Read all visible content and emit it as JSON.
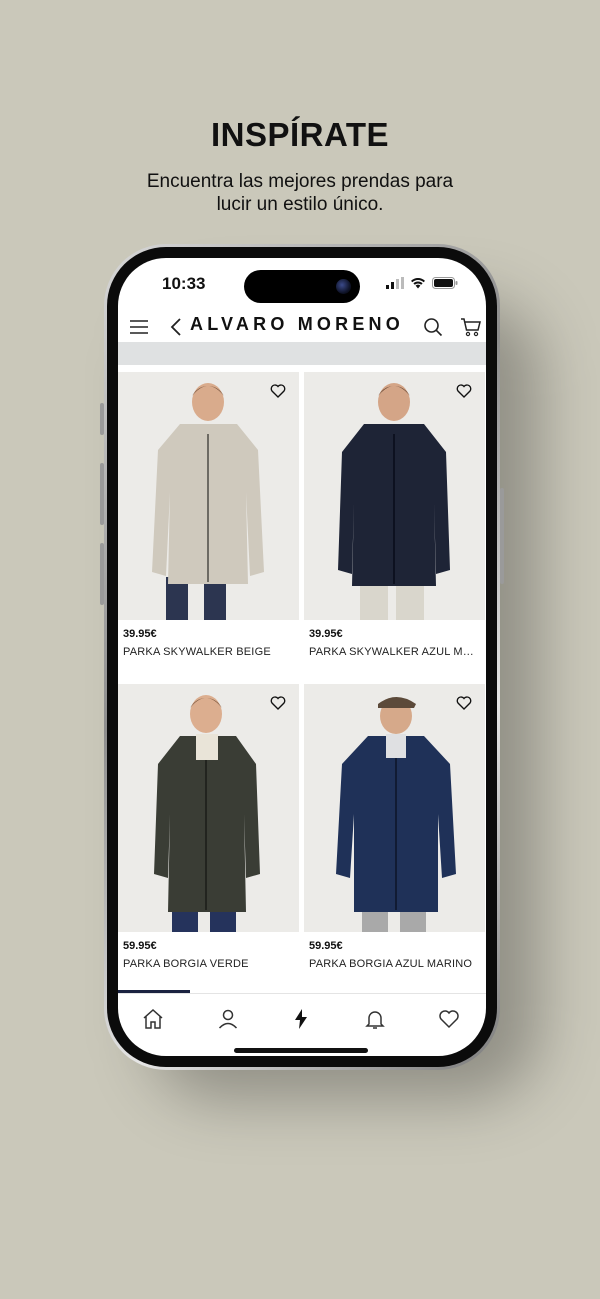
{
  "promo": {
    "title": "INSPÍRATE",
    "subtitle_line1": "Encuentra las mejores prendas para",
    "subtitle_line2": "lucir un estilo único."
  },
  "status_bar": {
    "time": "10:33"
  },
  "header": {
    "brand": "ALVARO MORENO"
  },
  "products": [
    {
      "price": "39.95€",
      "name": "PARKA SKYWALKER BEIGE",
      "coat_color": "#cfc9bd",
      "pants_color": "#2c3550"
    },
    {
      "price": "39.95€",
      "name": "PARKA SKYWALKER AZUL MARINO",
      "coat_color": "#1e2436",
      "pants_color": "#d9d6cc"
    },
    {
      "price": "59.95€",
      "name": "PARKA BORGIA VERDE",
      "coat_color": "#3a3d35",
      "pants_color": "#25335c"
    },
    {
      "price": "59.95€",
      "name": "PARKA BORGIA AZUL MARINO",
      "coat_color": "#1f3158",
      "pants_color": "#a9a9a9"
    }
  ],
  "tabbar": {
    "active_tab": "home",
    "icons": [
      "home-icon",
      "user-icon",
      "bolt-icon",
      "bell-icon",
      "heart-icon"
    ]
  },
  "colors": {
    "background": "#cac8ba",
    "accent": "#1a2240"
  }
}
